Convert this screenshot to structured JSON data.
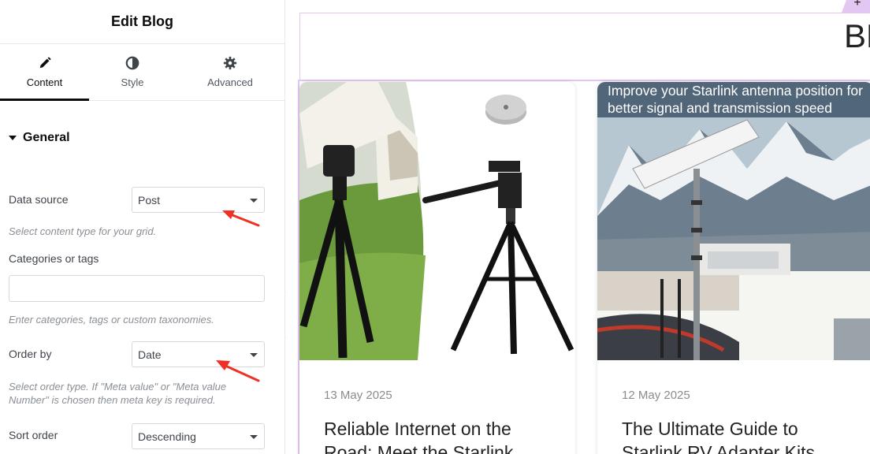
{
  "panel": {
    "title": "Edit Blog",
    "tabs": [
      {
        "label": "Content",
        "icon": "pencil-icon"
      },
      {
        "label": "Style",
        "icon": "half-circle-icon"
      },
      {
        "label": "Advanced",
        "icon": "gear-icon"
      }
    ],
    "section": "General",
    "fields": {
      "data_source": {
        "label": "Data source",
        "value": "Post",
        "desc": "Select content type for your grid."
      },
      "categories": {
        "label": "Categories or tags",
        "value": "",
        "desc": "Enter categories, tags or custom taxonomies."
      },
      "order_by": {
        "label": "Order by",
        "value": "Date",
        "desc": "Select order type. If \"Meta value\" or \"Meta value Number\" is chosen then meta key is required."
      },
      "sort_order": {
        "label": "Sort order",
        "value": "Descending"
      }
    }
  },
  "canvas": {
    "heading": "BL",
    "add_symbol": "+",
    "cards": [
      {
        "date": "13 May 2025",
        "title": "Reliable Internet on the Road: Meet the Starlink"
      },
      {
        "date": "12 May 2025",
        "title": "The Ultimate Guide to Starlink RV Adapter Kits",
        "image_caption": "Improve your Starlink antenna position for better signal and transmission speed"
      }
    ]
  },
  "colors": {
    "accent_outline": "#e3c6f2",
    "arrow": "#ee3124"
  }
}
